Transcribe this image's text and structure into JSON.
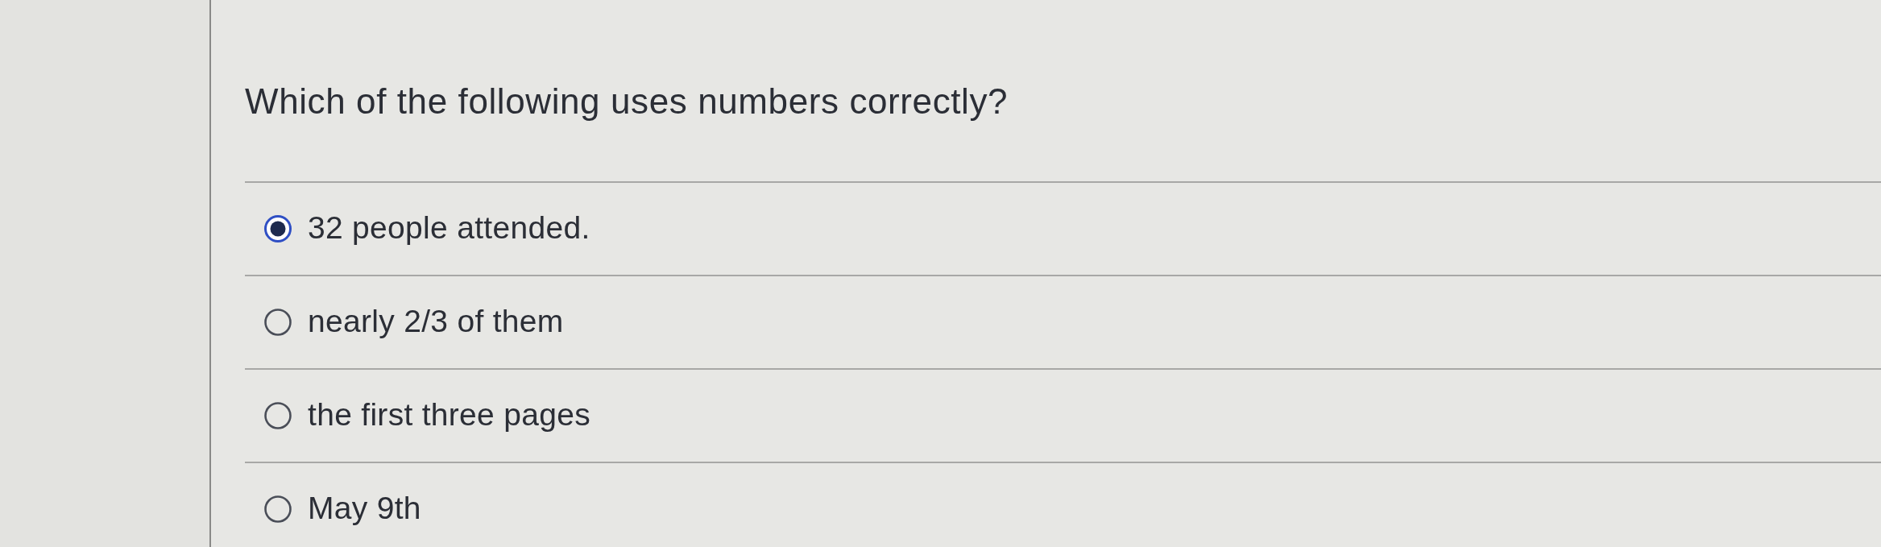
{
  "question": "Which of the following uses numbers correctly?",
  "options": [
    {
      "label": "32 people attended.",
      "selected": true
    },
    {
      "label": "nearly 2/3 of them",
      "selected": false
    },
    {
      "label": "the first three pages",
      "selected": false
    },
    {
      "label": "May 9th",
      "selected": false
    }
  ]
}
